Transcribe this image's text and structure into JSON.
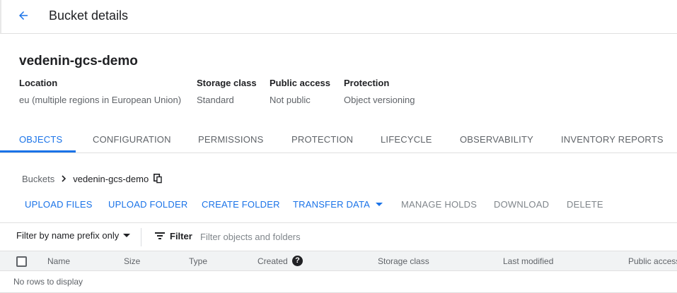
{
  "header": {
    "title": "Bucket details",
    "back_icon": "arrow-back-icon"
  },
  "bucket": {
    "name": "vedenin-gcs-demo",
    "meta": [
      {
        "label": "Location",
        "value": "eu (multiple regions in European Union)"
      },
      {
        "label": "Storage class",
        "value": "Standard"
      },
      {
        "label": "Public access",
        "value": "Not public"
      },
      {
        "label": "Protection",
        "value": "Object versioning"
      }
    ]
  },
  "tabs": [
    "OBJECTS",
    "CONFIGURATION",
    "PERMISSIONS",
    "PROTECTION",
    "LIFECYCLE",
    "OBSERVABILITY",
    "INVENTORY REPORTS"
  ],
  "active_tab": "OBJECTS",
  "breadcrumb": {
    "root": "Buckets",
    "current": "vedenin-gcs-demo",
    "separator_icon": "chevron-right-icon",
    "copy_icon": "copy-icon"
  },
  "actions": {
    "upload_files": "UPLOAD FILES",
    "upload_folder": "UPLOAD FOLDER",
    "create_folder": "CREATE FOLDER",
    "transfer_data": "TRANSFER DATA",
    "manage_holds": "MANAGE HOLDS",
    "download": "DOWNLOAD",
    "delete": "DELETE"
  },
  "filter": {
    "prefix_option": "Filter by name prefix only",
    "label": "Filter",
    "placeholder": "Filter objects and folders",
    "value": ""
  },
  "table": {
    "columns": [
      "Name",
      "Size",
      "Type",
      "Created",
      "Storage class",
      "Last modified",
      "Public access"
    ],
    "empty_message": "No rows to display"
  },
  "colors": {
    "accent": "#1a73e8",
    "text_primary": "#202124",
    "text_secondary": "#5f6368",
    "disabled": "#80868b",
    "header_bg": "#f1f3f4",
    "divider": "#e0e0e0"
  }
}
